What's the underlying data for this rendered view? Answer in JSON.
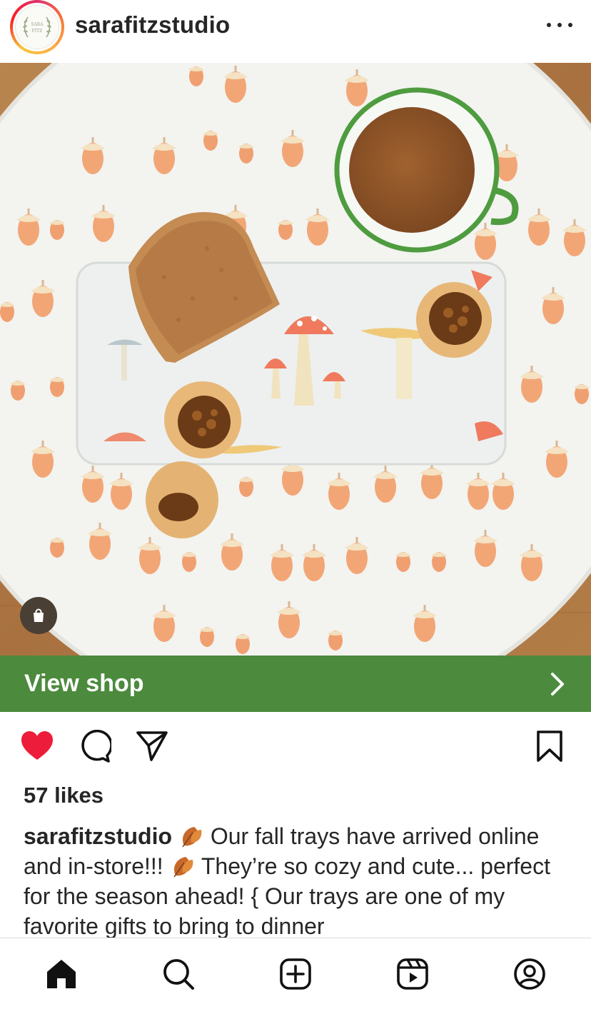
{
  "header": {
    "username": "sarafitzstudio",
    "avatar_text": "SARA FITZ",
    "more_icon": "more-horizontal-icon"
  },
  "post": {
    "image_alt_subject": "fall tray with acorn and mushroom pattern, tea cup, bread and tarts",
    "shop_tag_icon": "shopping-bag-icon"
  },
  "shop_bar": {
    "label": "View shop",
    "color": "#4c8a3d",
    "chevron_icon": "chevron-right-icon"
  },
  "actions": {
    "like_icon": "heart-filled-icon",
    "like_color": "#ed1c3a",
    "comment_icon": "comment-icon",
    "share_icon": "send-icon",
    "save_icon": "bookmark-icon"
  },
  "likes": {
    "text": "57 likes"
  },
  "caption": {
    "username": "sarafitzstudio",
    "part1": " Our fall trays have arrived online and in-store!!! ",
    "part2": " They’re so cozy and cute... perfect for the season ahead! { Our trays are one of my favorite gifts to bring to dinner"
  },
  "bottom_nav": {
    "items": [
      {
        "name": "home",
        "icon": "home-icon"
      },
      {
        "name": "search",
        "icon": "search-icon"
      },
      {
        "name": "create",
        "icon": "plus-square-icon"
      },
      {
        "name": "reels",
        "icon": "reels-icon"
      },
      {
        "name": "profile",
        "icon": "profile-icon"
      }
    ]
  }
}
